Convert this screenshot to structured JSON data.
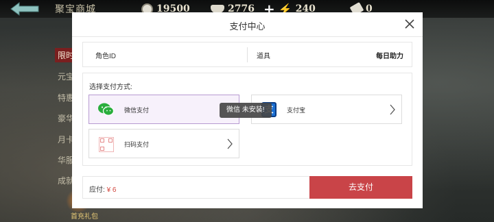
{
  "game": {
    "shop_title": "聚宝商城",
    "resources": {
      "coins": "19500",
      "ingots": "2776",
      "stamina": "240",
      "tickets": "0"
    },
    "side_menu": [
      "限时",
      "元宝",
      "特惠",
      "豪华",
      "月卡",
      "华服",
      "成就"
    ],
    "gift_label": "首充礼包"
  },
  "dialog": {
    "title": "支付中心",
    "role_label": "角色ID",
    "item_label": "道具",
    "item_value": "每日助力",
    "method_prompt": "选择支付方式:",
    "options": {
      "wechat": "微信支付",
      "alipay": "支付宝",
      "qr": "扫码支付"
    },
    "toast": "微信 未安装!",
    "due_label": "应付: ",
    "due_amount": "¥ 6",
    "pay_button": "去支付"
  },
  "colors": {
    "pay_button": "#c94448",
    "price": "#d2453c",
    "selected_border": "#b79ad1",
    "wechat": "#2aae3c",
    "alipay": "#1c6fd1"
  }
}
